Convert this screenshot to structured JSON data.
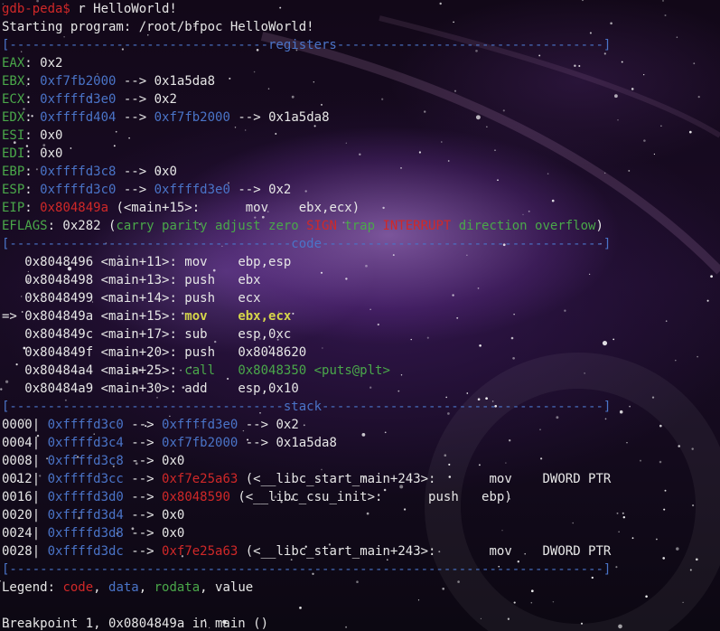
{
  "prompt": {
    "text": "gdb-peda$",
    "command": " r HelloWorld!"
  },
  "starting": "Starting program: /root/bfpoc HelloWorld!",
  "sep_registers": "[----------------------------------registers-----------------------------------]",
  "registers": [
    {
      "name": "EAX",
      "segs": [
        {
          "t": ": ",
          "c": "white"
        },
        {
          "t": "0x2",
          "c": "white"
        }
      ]
    },
    {
      "name": "EBX",
      "segs": [
        {
          "t": ": ",
          "c": "white"
        },
        {
          "t": "0xf7fb2000",
          "c": "blue"
        },
        {
          "t": " --> ",
          "c": "white"
        },
        {
          "t": "0x1a5da8",
          "c": "white"
        }
      ]
    },
    {
      "name": "ECX",
      "segs": [
        {
          "t": ": ",
          "c": "white"
        },
        {
          "t": "0xffffd3e0",
          "c": "blue"
        },
        {
          "t": " --> ",
          "c": "white"
        },
        {
          "t": "0x2",
          "c": "white"
        }
      ]
    },
    {
      "name": "EDX",
      "segs": [
        {
          "t": ": ",
          "c": "white"
        },
        {
          "t": "0xffffd404",
          "c": "blue"
        },
        {
          "t": " --> ",
          "c": "white"
        },
        {
          "t": "0xf7fb2000",
          "c": "blue"
        },
        {
          "t": " --> ",
          "c": "white"
        },
        {
          "t": "0x1a5da8",
          "c": "white"
        }
      ]
    },
    {
      "name": "ESI",
      "segs": [
        {
          "t": ": ",
          "c": "white"
        },
        {
          "t": "0x0",
          "c": "white"
        }
      ]
    },
    {
      "name": "EDI",
      "segs": [
        {
          "t": ": ",
          "c": "white"
        },
        {
          "t": "0x0",
          "c": "white"
        }
      ]
    },
    {
      "name": "EBP",
      "segs": [
        {
          "t": ": ",
          "c": "white"
        },
        {
          "t": "0xffffd3c8",
          "c": "blue"
        },
        {
          "t": " --> ",
          "c": "white"
        },
        {
          "t": "0x0",
          "c": "white"
        }
      ]
    },
    {
      "name": "ESP",
      "segs": [
        {
          "t": ": ",
          "c": "white"
        },
        {
          "t": "0xffffd3c0",
          "c": "blue"
        },
        {
          "t": " --> ",
          "c": "white"
        },
        {
          "t": "0xffffd3e0",
          "c": "blue"
        },
        {
          "t": " --> ",
          "c": "white"
        },
        {
          "t": "0x2",
          "c": "white"
        }
      ]
    },
    {
      "name": "EIP",
      "segs": [
        {
          "t": ": ",
          "c": "white"
        },
        {
          "t": "0x804849a",
          "c": "red"
        },
        {
          "t": " (<main+15>:      mov    ebx,ecx)",
          "c": "white"
        }
      ]
    },
    {
      "name": "EFLAGS",
      "segs": [
        {
          "t": ": 0x282 (",
          "c": "white"
        },
        {
          "t": "carry parity adjust zero ",
          "c": "green"
        },
        {
          "t": "SIGN",
          "c": "red"
        },
        {
          "t": " trap ",
          "c": "green"
        },
        {
          "t": "INTERRUPT",
          "c": "red"
        },
        {
          "t": " direction overflow",
          "c": "green"
        },
        {
          "t": ")",
          "c": "white"
        }
      ]
    }
  ],
  "sep_code": "[-------------------------------------code-------------------------------------]",
  "code": [
    {
      "marker": "   ",
      "addr": "0x8048496",
      "sym": " <main+11>:",
      "op": " mov    ",
      "args": "ebp,esp",
      "style": "normal"
    },
    {
      "marker": "   ",
      "addr": "0x8048498",
      "sym": " <main+13>:",
      "op": " push   ",
      "args": "ebx",
      "style": "normal"
    },
    {
      "marker": "   ",
      "addr": "0x8048499",
      "sym": " <main+14>:",
      "op": " push   ",
      "args": "ecx",
      "style": "normal"
    },
    {
      "marker": "=> ",
      "addr": "0x804849a",
      "sym": " <main+15>:",
      "op": " mov    ",
      "args": "ebx,ecx",
      "style": "current"
    },
    {
      "marker": "   ",
      "addr": "0x804849c",
      "sym": " <main+17>:",
      "op": " sub    ",
      "args": "esp,0xc",
      "style": "normal"
    },
    {
      "marker": "   ",
      "addr": "0x804849f",
      "sym": " <main+20>:",
      "op": " push   ",
      "args": "0x8048620",
      "style": "normal"
    },
    {
      "marker": "   ",
      "addr": "0x80484a4",
      "sym": " <main+25>:",
      "op": " call   ",
      "args": "0x8048350 <puts@plt>",
      "style": "call"
    },
    {
      "marker": "   ",
      "addr": "0x80484a9",
      "sym": " <main+30>:",
      "op": " add    ",
      "args": "esp,0x10",
      "style": "normal"
    }
  ],
  "sep_stack": "[------------------------------------stack-------------------------------------]",
  "stack": [
    {
      "off": "0000| ",
      "segs": [
        {
          "t": "0xffffd3c0",
          "c": "blue"
        },
        {
          "t": " --> ",
          "c": "white"
        },
        {
          "t": "0xffffd3e0",
          "c": "blue"
        },
        {
          "t": " --> ",
          "c": "white"
        },
        {
          "t": "0x2",
          "c": "white"
        }
      ]
    },
    {
      "off": "0004| ",
      "segs": [
        {
          "t": "0xffffd3c4",
          "c": "blue"
        },
        {
          "t": " --> ",
          "c": "white"
        },
        {
          "t": "0xf7fb2000",
          "c": "blue"
        },
        {
          "t": " --> ",
          "c": "white"
        },
        {
          "t": "0x1a5da8",
          "c": "white"
        }
      ]
    },
    {
      "off": "0008| ",
      "segs": [
        {
          "t": "0xffffd3c8",
          "c": "blue"
        },
        {
          "t": " --> ",
          "c": "white"
        },
        {
          "t": "0x0",
          "c": "white"
        }
      ]
    },
    {
      "off": "0012| ",
      "segs": [
        {
          "t": "0xffffd3cc",
          "c": "blue"
        },
        {
          "t": " --> ",
          "c": "white"
        },
        {
          "t": "0xf7e25a63",
          "c": "red"
        },
        {
          "t": " (<__libc_start_main+243>:       mov    DWORD PTR",
          "c": "white"
        }
      ]
    },
    {
      "off": "0016| ",
      "segs": [
        {
          "t": "0xffffd3d0",
          "c": "blue"
        },
        {
          "t": " --> ",
          "c": "white"
        },
        {
          "t": "0x8048590",
          "c": "red"
        },
        {
          "t": " (<__libc_csu_init>:      push   ebp)",
          "c": "white"
        }
      ]
    },
    {
      "off": "0020| ",
      "segs": [
        {
          "t": "0xffffd3d4",
          "c": "blue"
        },
        {
          "t": " --> ",
          "c": "white"
        },
        {
          "t": "0x0",
          "c": "white"
        }
      ]
    },
    {
      "off": "0024| ",
      "segs": [
        {
          "t": "0xffffd3d8",
          "c": "blue"
        },
        {
          "t": " --> ",
          "c": "white"
        },
        {
          "t": "0x0",
          "c": "white"
        }
      ]
    },
    {
      "off": "0028| ",
      "segs": [
        {
          "t": "0xffffd3dc",
          "c": "blue"
        },
        {
          "t": " --> ",
          "c": "white"
        },
        {
          "t": "0xf7e25a63",
          "c": "red"
        },
        {
          "t": " (<__libc_start_main+243>:       mov    DWORD PTR",
          "c": "white"
        }
      ]
    }
  ],
  "sep_end": "[------------------------------------------------------------------------------]",
  "legend": {
    "label": "Legend: ",
    "code": "code",
    "data": "data",
    "rodata": "rodata",
    "value": "value",
    "comma": ", "
  },
  "breakpoint": "Breakpoint 1, 0x0804849a in main ()",
  "colors": {
    "code": "#d02828",
    "data": "#4a74c8",
    "rodata": "#4aa84a",
    "value": "#e6e6e6",
    "prompt": "#d02828",
    "separator": "#4a74c8"
  }
}
